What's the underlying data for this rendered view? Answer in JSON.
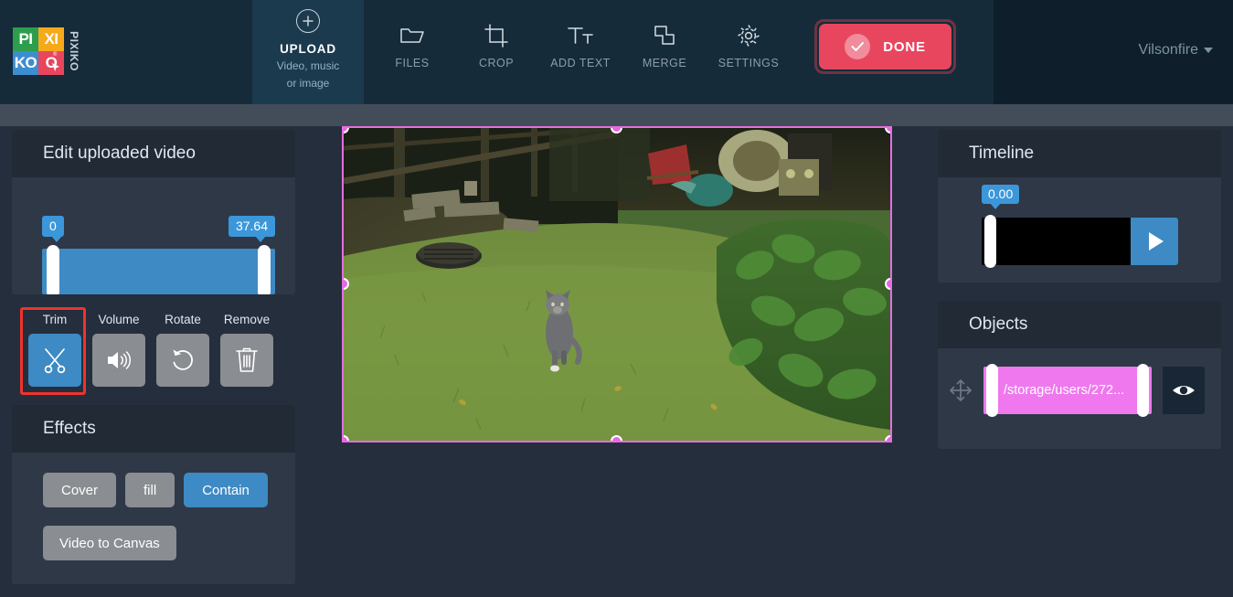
{
  "header": {
    "logo": {
      "cells": [
        "PI",
        "XI",
        "KO",
        "O"
      ],
      "vertical_text": "PIXIKO",
      "registered_mark": "®",
      "icon": "pixiko-logo"
    },
    "upload": {
      "title": "UPLOAD",
      "subtitle_line1": "Video, music",
      "subtitle_line2": "or image",
      "icon": "plus-circle-icon"
    },
    "tools": [
      {
        "label": "FILES",
        "icon": "folder-icon"
      },
      {
        "label": "CROP",
        "icon": "crop-icon"
      },
      {
        "label": "ADD TEXT",
        "icon": "text-icon"
      },
      {
        "label": "MERGE",
        "icon": "merge-icon"
      },
      {
        "label": "SETTINGS",
        "icon": "gear-icon"
      }
    ],
    "done": {
      "label": "DONE",
      "icon": "check-circle-icon"
    },
    "user": {
      "name": "Vilsonfire",
      "icon": "chevron-down-icon"
    }
  },
  "left_panel": {
    "edit_card": {
      "title": "Edit uploaded video",
      "trim_range": {
        "start": "0",
        "end": "37.64"
      }
    },
    "tool_buttons": [
      {
        "label": "Trim",
        "icon": "scissors-icon",
        "active": true
      },
      {
        "label": "Volume",
        "icon": "speaker-icon",
        "active": false
      },
      {
        "label": "Rotate",
        "icon": "rotate-ccw-icon",
        "active": false
      },
      {
        "label": "Remove",
        "icon": "trash-icon",
        "active": false
      }
    ],
    "effects_card": {
      "title": "Effects",
      "fit_options": [
        {
          "label": "Cover",
          "active": false
        },
        {
          "label": "fill",
          "active": false
        },
        {
          "label": "Contain",
          "active": true
        }
      ],
      "video_to_canvas": {
        "label": "Video to Canvas"
      }
    }
  },
  "stage": {
    "name": "video-preview",
    "handles": [
      "top-left",
      "top-center",
      "top-right",
      "middle-left",
      "middle-right",
      "bottom-left",
      "bottom-center",
      "bottom-right"
    ]
  },
  "right_panel": {
    "timeline_card": {
      "title": "Timeline",
      "current_time": "0.00",
      "play_icon": "play-icon"
    },
    "objects_card": {
      "title": "Objects",
      "items": [
        {
          "label": "/storage/users/272...",
          "move_icon": "move-icon",
          "visibility_icon": "eye-icon"
        }
      ]
    }
  },
  "colors": {
    "header_bg": "#152b3a",
    "header_right_bg": "#0e1f2b",
    "page_bg": "#252e3c",
    "panel_bg": "#2e3847",
    "panel_head_bg": "#222a36",
    "accent_blue": "#3d8ac4",
    "accent_red": "#e8465f",
    "annotation_red": "#f0322c",
    "object_pink": "#ef78ee",
    "handle_pink": "#ea64e4",
    "button_grey": "#8a8d91"
  }
}
